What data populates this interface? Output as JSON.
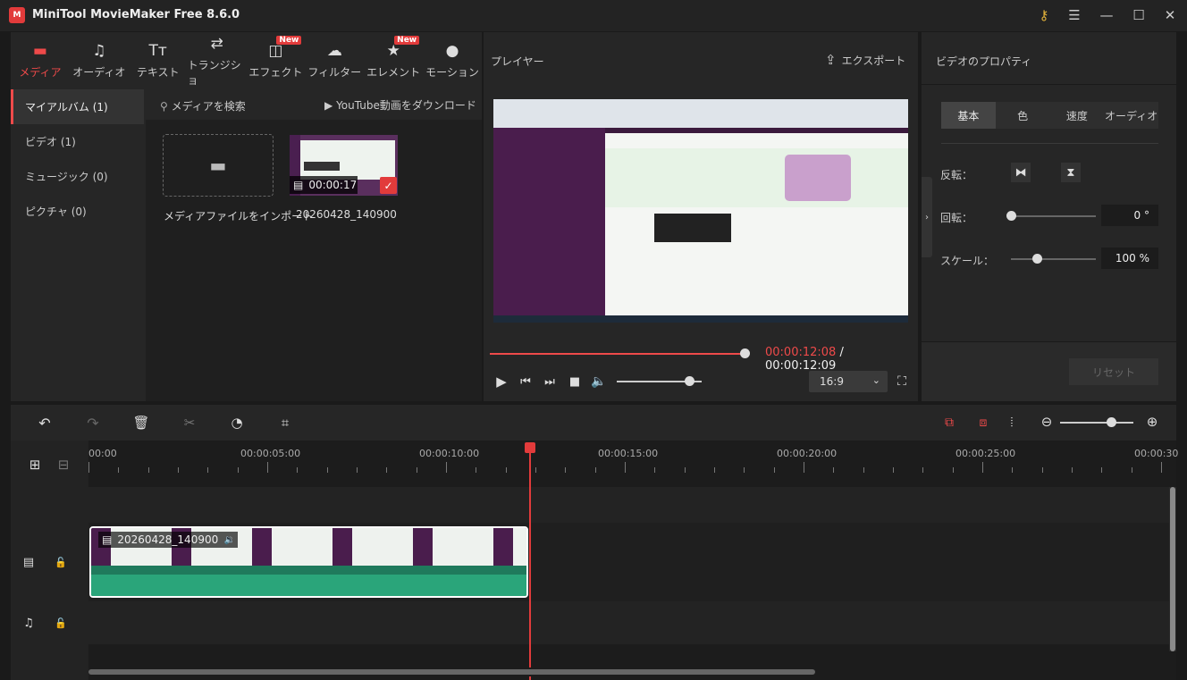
{
  "app": {
    "title": "MiniTool MovieMaker Free 8.6.0",
    "logo_text": "M"
  },
  "toolbar": {
    "items": [
      {
        "label": "メディア",
        "icon": "folder-icon",
        "glyph": "▬",
        "active": true,
        "badge": ""
      },
      {
        "label": "オーディオ",
        "icon": "music-note-icon",
        "glyph": "♫",
        "active": false,
        "badge": ""
      },
      {
        "label": "テキスト",
        "icon": "text-icon",
        "glyph": "Tт",
        "active": false,
        "badge": ""
      },
      {
        "label": "トランジショ",
        "icon": "transition-icon",
        "glyph": "⇄",
        "active": false,
        "badge": ""
      },
      {
        "label": "エフェクト",
        "icon": "effect-icon",
        "glyph": "◫",
        "active": false,
        "badge": "New"
      },
      {
        "label": "フィルター",
        "icon": "filter-icon",
        "glyph": "☁",
        "active": false,
        "badge": ""
      },
      {
        "label": "エレメント",
        "icon": "element-icon",
        "glyph": "★",
        "active": false,
        "badge": "New"
      },
      {
        "label": "モーション",
        "icon": "motion-icon",
        "glyph": "●",
        "active": false,
        "badge": ""
      }
    ]
  },
  "sidebar": {
    "items": [
      {
        "label": "マイアルバム (1)",
        "active": true
      },
      {
        "label": "ビデオ (1)",
        "active": false
      },
      {
        "label": "ミュージック (0)",
        "active": false
      },
      {
        "label": "ピクチャ (0)",
        "active": false
      }
    ]
  },
  "media": {
    "search_label": "メディアを検索",
    "youtube_label": "YouTube動画をダウンロード",
    "import_label": "メディアファイルをインポート",
    "clip_name": "20260428_140900",
    "clip_duration": "00:00:17"
  },
  "player": {
    "title": "プレイヤー",
    "export_label": "エクスポート",
    "current_time": "00:00:12:08",
    "separator": " / ",
    "total_time": "00:00:12:09",
    "progress": 0.99,
    "volume": 0.85,
    "aspect_ratio": "16:9"
  },
  "properties": {
    "title": "ビデオのプロパティ",
    "tabs": [
      "基本",
      "色",
      "速度",
      "オーディオ"
    ],
    "active_tab": 0,
    "flip_label": "反転：",
    "rotate_label": "回転：",
    "rotate_value": "0 °",
    "rotate_level": 0.0,
    "scale_label": "スケール：",
    "scale_value": "100 %",
    "scale_level": 0.3,
    "reset_label": "リセット"
  },
  "timeline": {
    "ruler": [
      "00:00",
      "00:00:05:00",
      "00:00:10:00",
      "00:00:15:00",
      "00:00:20:00",
      "00:00:25:00",
      "00:00:30"
    ],
    "clip_name": "20260428_140900",
    "playhead_time": "00:00:12:08",
    "zoom_level": 0.7
  },
  "colors": {
    "accent": "#ee4a4a",
    "waveform": "#2aa57a",
    "bg": "#262626"
  }
}
